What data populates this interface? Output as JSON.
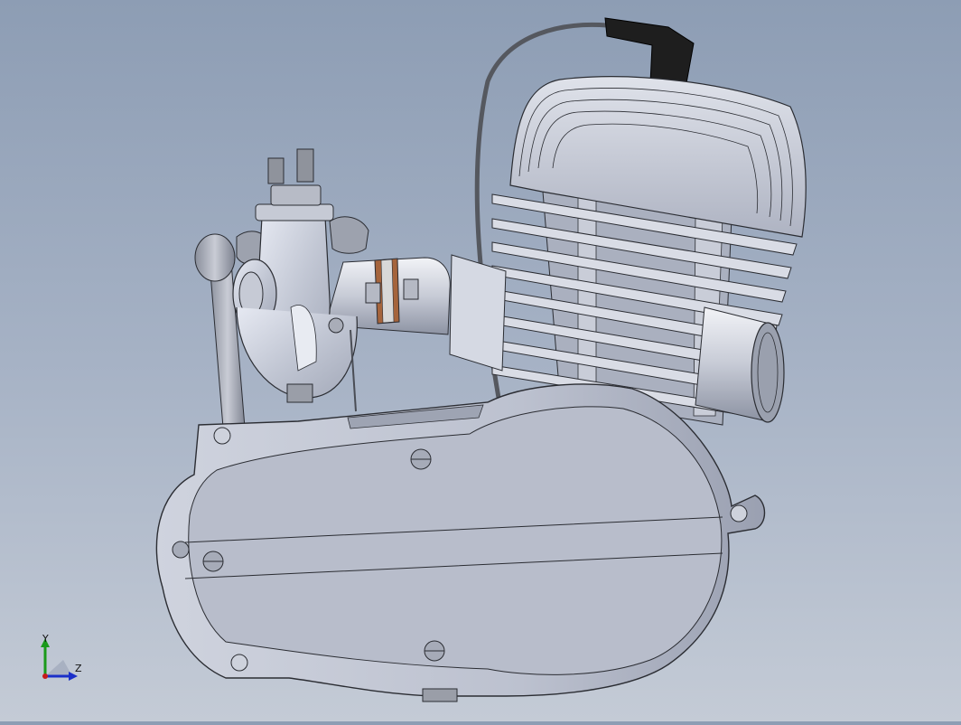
{
  "viewport": {
    "model": "engine-assembly",
    "colors": {
      "bg_top": "#8d9db4",
      "bg_bottom": "#c4cbd6",
      "metal_light": "#dde1ec",
      "metal_mid": "#b3b9c8",
      "metal_dark": "#7f8596",
      "edge": "#2b2d33",
      "spark_cap": "#1e1e1e",
      "copper_gasket": "#a5643c"
    }
  },
  "triad": {
    "y_label": "Y",
    "z_label": "Z"
  }
}
